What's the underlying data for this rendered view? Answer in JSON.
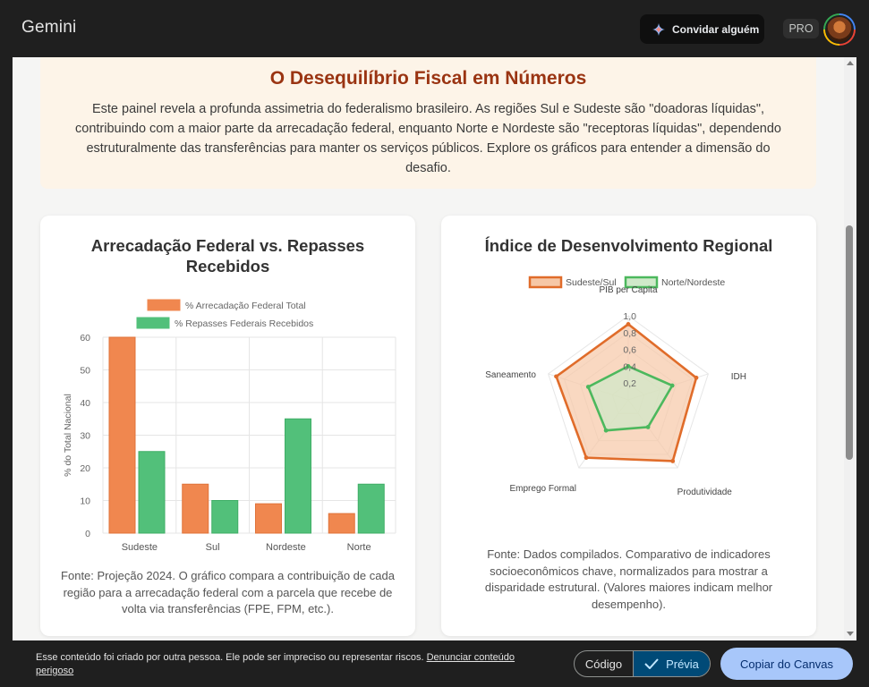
{
  "app": {
    "brand": "Gemini",
    "invite_label": "Convidar alguém",
    "pro_label": "PRO"
  },
  "intro": {
    "title": "O Desequilíbrio Fiscal em Números",
    "text": "Este painel revela a profunda assimetria do federalismo brasileiro. As regiões Sul e Sudeste são \"doadoras líquidas\", contribuindo com a maior parte da arrecadação federal, enquanto Norte e Nordeste são \"receptoras líquidas\", dependendo estruturalmente das transferências para manter os serviços públicos. Explore os gráficos para entender a dimensão do desafio."
  },
  "bar_card": {
    "title": "Arrecadação Federal vs. Repasses Recebidos",
    "source": "Fonte: Projeção 2024. O gráfico compara a contribuição de cada região para a arrecadação federal com a parcela que recebe de volta via transferências (FPE, FPM, etc.)."
  },
  "radar_card": {
    "title": "Índice de Desenvolvimento Regional",
    "source": "Fonte: Dados compilados. Comparativo de indicadores socioeconômicos chave, normalizados para mostrar a disparidade estrutural. (Valores maiores indicam melhor desempenho)."
  },
  "chart_data": [
    {
      "type": "bar",
      "title": "Arrecadação Federal vs. Repasses Recebidos",
      "categories": [
        "Sudeste",
        "Sul",
        "Nordeste",
        "Norte"
      ],
      "series": [
        {
          "name": "% Arrecadação Federal Total",
          "values": [
            60,
            15,
            9,
            6
          ],
          "color": "#f0874f"
        },
        {
          "name": "% Repasses Federais Recebidos",
          "values": [
            25,
            10,
            35,
            15
          ],
          "color": "#52c07a"
        }
      ],
      "ylabel": "% do Total Nacional",
      "ylim": [
        0,
        60
      ],
      "yticks": [
        0,
        10,
        20,
        30,
        40,
        50,
        60
      ],
      "grid": true,
      "legend": "top"
    },
    {
      "type": "radar",
      "title": "Índice de Desenvolvimento Regional",
      "axes": [
        "PIB per Capita",
        "IDH",
        "Produtividade",
        "Emprego Formal",
        "Saneamento"
      ],
      "series": [
        {
          "name": "Sudeste/Sul",
          "values": [
            0.9,
            0.85,
            0.9,
            0.85,
            0.9
          ],
          "color": "#e06c2a",
          "fill": "#f6c7a6"
        },
        {
          "name": "Norte/Nordeste",
          "values": [
            0.4,
            0.55,
            0.4,
            0.45,
            0.5
          ],
          "color": "#4cb85d",
          "fill": "#cfe9c9"
        }
      ],
      "rlim": [
        0,
        1
      ],
      "rticks": [
        "0,2",
        "0,4",
        "0,6",
        "0,8",
        "1,0"
      ],
      "legend": "top"
    }
  ],
  "footer": {
    "disclaimer": "Esse conteúdo foi criado por outra pessoa. Ele pode ser impreciso ou representar riscos.",
    "report_link": "Denunciar conteúdo perigoso",
    "code_label": "Código",
    "preview_label": "Prévia",
    "copy_label": "Copiar do Canvas"
  }
}
